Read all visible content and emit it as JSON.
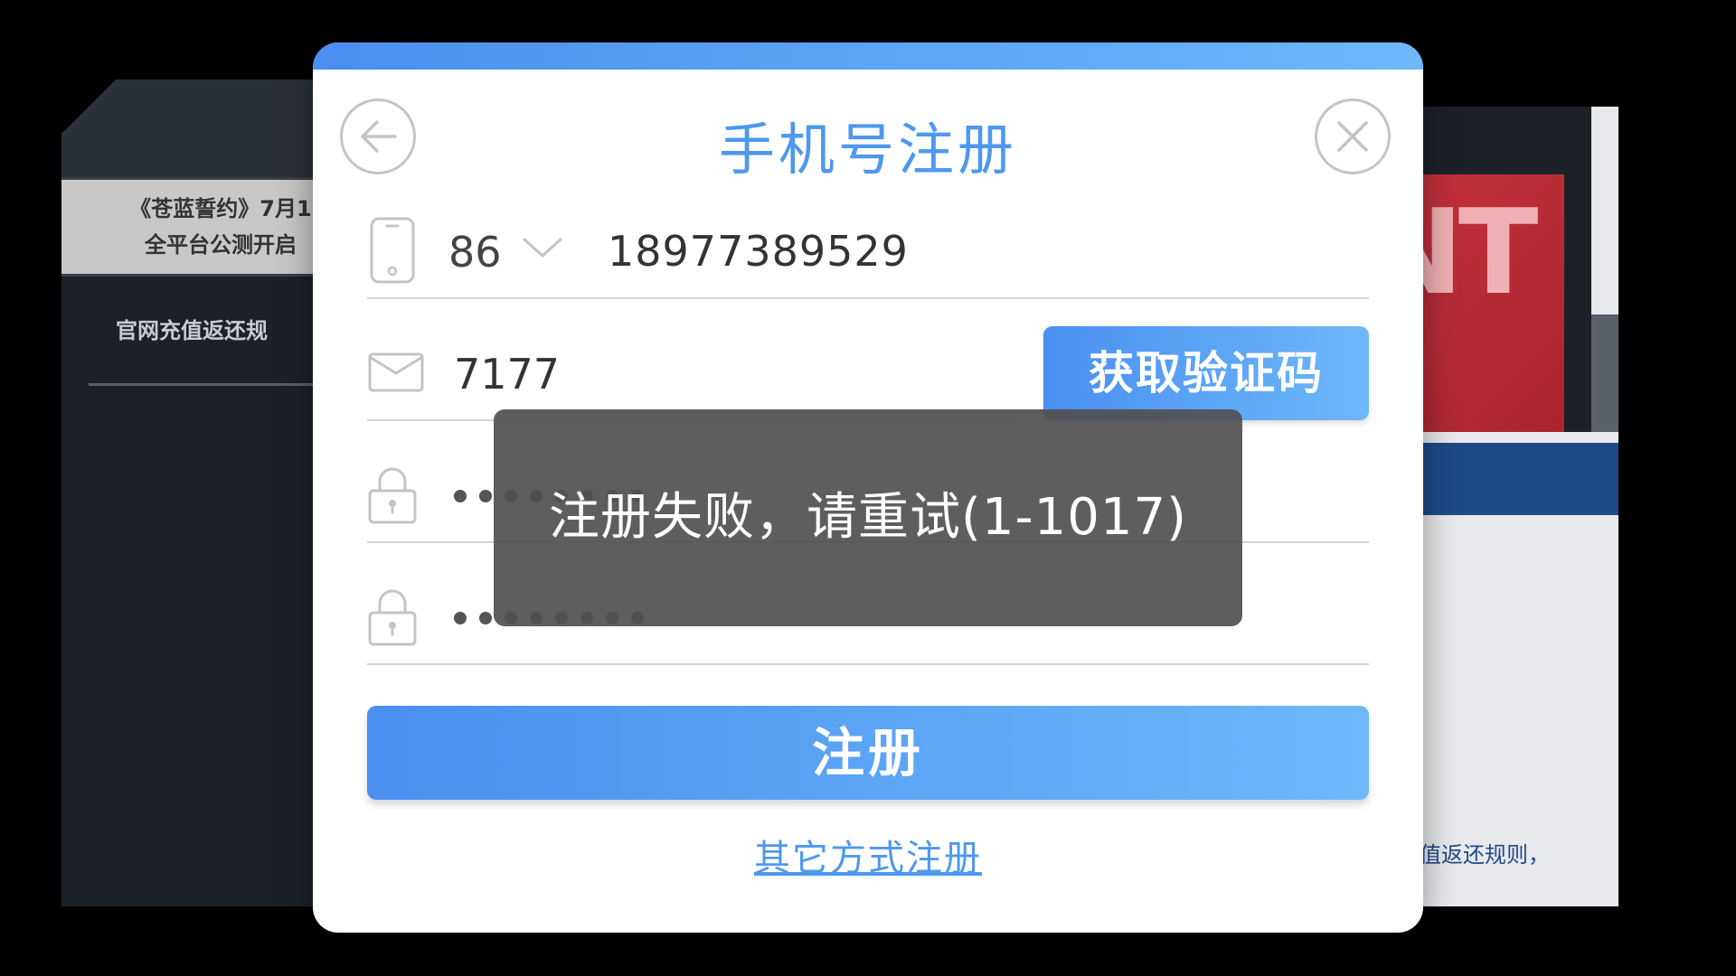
{
  "background": {
    "left_notice_line1": "《苍蓝誓约》7月1",
    "left_notice_line2": "全平台公测开启",
    "left_rule_text": "官网充值返还规",
    "right_banner_text": "NT",
    "right_rule_text": "值返还规则，"
  },
  "dialog": {
    "title": "手机号注册",
    "back_icon": "arrow-left-icon",
    "close_icon": "close-x-icon",
    "phone": {
      "icon": "mobile-phone-icon",
      "country_code": "86",
      "value": "18977389529"
    },
    "code": {
      "icon": "envelope-icon",
      "value": "7177",
      "get_code_label": "获取验证码"
    },
    "password": {
      "icon": "lock-icon",
      "mask_count": 8
    },
    "confirm_password": {
      "icon": "lock-icon",
      "mask_count": 8
    },
    "register_label": "注册",
    "other_methods_label": "其它方式注册"
  },
  "toast": {
    "message": "注册失败，请重试(1-1017)"
  },
  "colors": {
    "accent": "#4e98ee",
    "gradient_start": "#4a8ff0",
    "gradient_end": "#6db8fa",
    "toast_bg": "#505050"
  }
}
